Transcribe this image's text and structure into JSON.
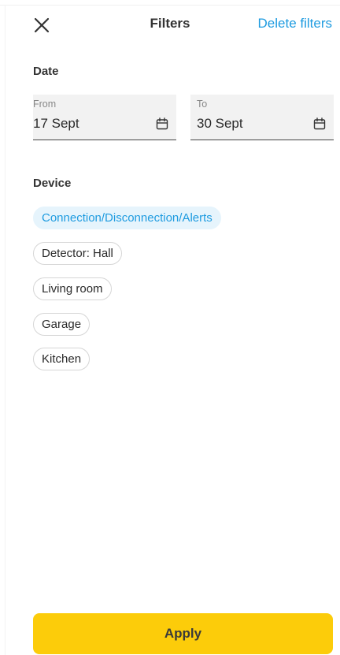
{
  "header": {
    "title": "Filters",
    "delete_label": "Delete filters"
  },
  "date": {
    "section_title": "Date",
    "from": {
      "label": "From",
      "value": "17 Sept"
    },
    "to": {
      "label": "To",
      "value": "30 Sept"
    }
  },
  "device": {
    "section_title": "Device",
    "chips": [
      {
        "label": "Connection/Disconnection/Alerts",
        "selected": true
      },
      {
        "label": "Detector: Hall",
        "selected": false
      },
      {
        "label": "Living room",
        "selected": false
      },
      {
        "label": "Garage",
        "selected": false
      },
      {
        "label": "Kitchen",
        "selected": false
      }
    ]
  },
  "footer": {
    "apply_label": "Apply"
  },
  "colors": {
    "accent": "#1e9be0",
    "selected_chip_bg": "#e6f4fc",
    "apply_bg": "#fccc0a"
  }
}
